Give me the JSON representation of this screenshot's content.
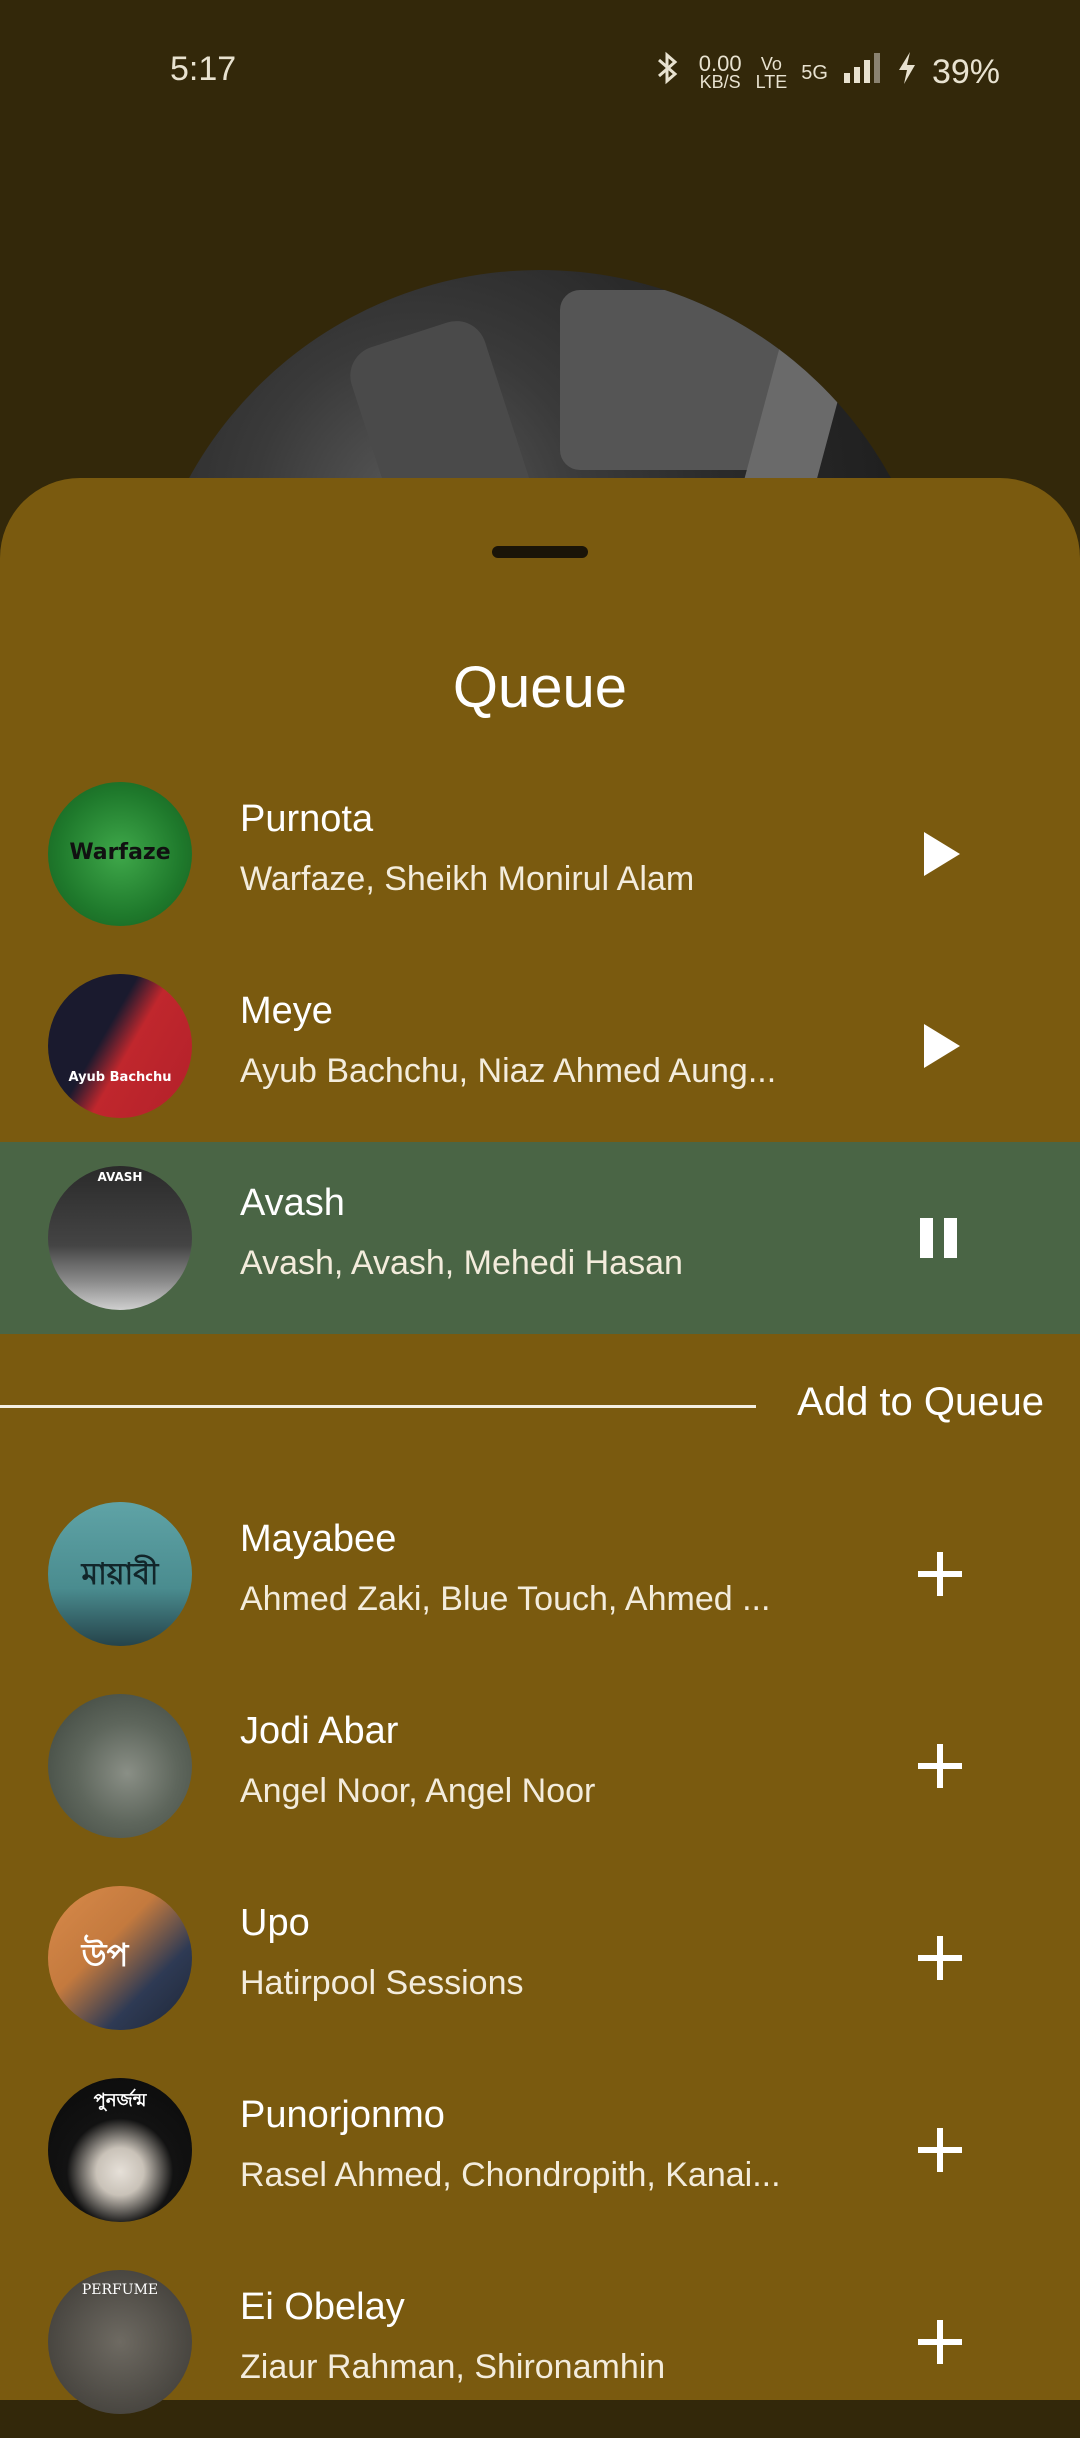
{
  "status_bar": {
    "time": "5:17",
    "net_speed_value": "0.00",
    "net_speed_unit": "KB/S",
    "volte_top": "Vo",
    "volte_bottom": "LTE",
    "network": "5G",
    "battery": "39%"
  },
  "queue": {
    "title": "Queue",
    "items": [
      {
        "title": "Purnota",
        "artist": "Warfaze, Sheikh Monirul Alam",
        "thumb_text": "Warfaze",
        "state": "play"
      },
      {
        "title": "Meye",
        "artist": "Ayub Bachchu, Niaz Ahmed Aung...",
        "thumb_text": "Ayub Bachchu",
        "state": "play"
      },
      {
        "title": "Avash",
        "artist": "Avash, Avash, Mehedi Hasan",
        "thumb_text": "AVASH",
        "state": "pause"
      }
    ]
  },
  "add_section": {
    "label": "Add to Queue",
    "items": [
      {
        "title": "Mayabee",
        "artist": "Ahmed Zaki, Blue Touch, Ahmed ...",
        "thumb_text": "মায়াবী"
      },
      {
        "title": "Jodi Abar",
        "artist": "Angel Noor, Angel Noor",
        "thumb_text": ""
      },
      {
        "title": "Upo",
        "artist": "Hatirpool Sessions",
        "thumb_text": "উপ"
      },
      {
        "title": "Punorjonmo",
        "artist": "Rasel Ahmed, Chondropith, Kanai...",
        "thumb_text": "পুনর্জন্ম"
      },
      {
        "title": "Ei Obelay",
        "artist": "Ziaur Rahman, Shironamhin",
        "thumb_text": "PERFUME"
      }
    ]
  },
  "icons": {
    "play": "play-icon",
    "pause": "pause-icon",
    "add": "plus-icon"
  },
  "colors": {
    "sheet_background": "#7a5a0f",
    "active_row": "#4a6545",
    "top_background": "#33280a"
  }
}
